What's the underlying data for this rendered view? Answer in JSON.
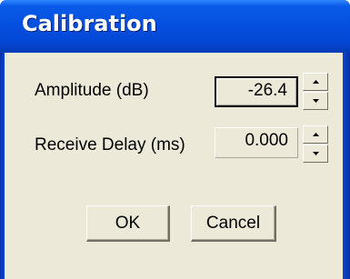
{
  "window": {
    "title": "Calibration"
  },
  "fields": {
    "amplitude": {
      "label": "Amplitude (dB)",
      "value": "-26.4"
    },
    "receive_delay": {
      "label": "Receive Delay (ms)",
      "value": "0.000"
    }
  },
  "buttons": {
    "ok": "OK",
    "cancel": "Cancel"
  },
  "icons": {
    "spin_up": "arrow-up-icon",
    "spin_down": "arrow-down-icon"
  },
  "colors": {
    "titlebar": "#0550e0",
    "dialog_face": "#ece9d8",
    "title_text": "#ffffff"
  }
}
